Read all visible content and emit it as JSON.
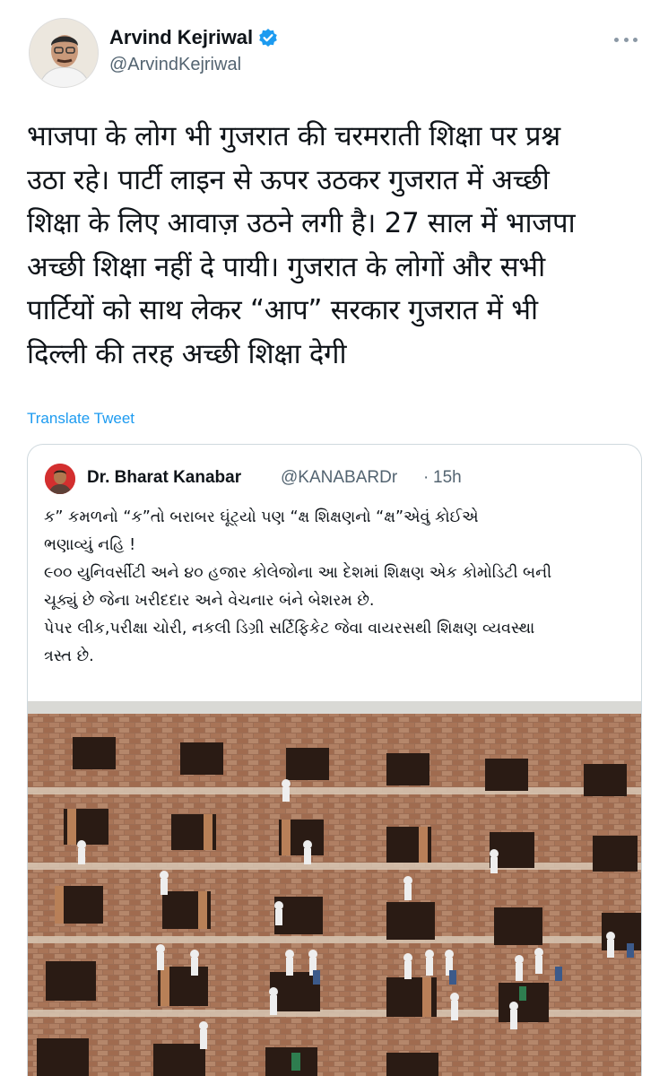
{
  "author": {
    "name": "Arvind Kejriwal",
    "handle": "@ArvindKejriwal"
  },
  "tweet": {
    "text": "भाजपा के लोग भी गुजरात की चरमराती शिक्षा पर प्रश्न\nउठा रहे। पार्टी लाइन से ऊपर उठकर गुजरात में अच्छी\nशिक्षा के लिए आवाज़ उठने लगी है। 27 साल में भाजपा\nअच्छी शिक्षा नहीं दे पायी। गुजरात के लोगों और सभी\nपार्टियों को साथ लेकर “आप” सरकार गुजरात में भी\nदिल्ली की तरह अच्छी शिक्षा देगी",
    "translate_label": "Translate Tweet"
  },
  "quoted": {
    "name": "Dr. Bharat Kanabar",
    "handle": "@KANABARDr",
    "separator": "·",
    "time": "15h",
    "text": "ક” કમળનો “ક”તો બરાબર ઘૂંટ્યો પણ “ક્ષ શિક્ષણનો “ક્ષ”એવું કોઈએ\nભણાવ્યું નહિ !\n૯૦૦ યુનિવર્સીટી અને ૪૦ હજાર કોલેજોના આ દેશમાં શિક્ષણ એક કોમોડિટી બની\nચૂક્યું છે જેના ખરીદદાર અને વેચનાર બંને બેશરમ છે.\nપેપર લીક,પરીક્ષા ચોરી, નકલી ડિગ્રી સર્ટિફિકેટ જેવા વાયરસથી શિક્ષણ વ્યવસ્થા\nત્રસ્ત છે."
  },
  "colors": {
    "link": "#1d9bf0",
    "verified": "#1d9bf0",
    "secondary_text": "#536471",
    "border": "#cfd9de"
  },
  "icons": {
    "verified": "verified-badge-icon",
    "more": "more-horizontal-icon"
  }
}
